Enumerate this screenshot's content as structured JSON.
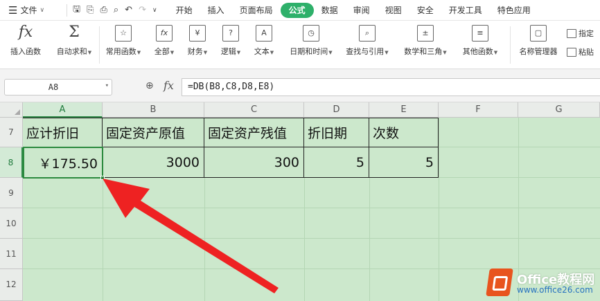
{
  "menu": {
    "file_label": "文件",
    "tabs": [
      "开始",
      "插入",
      "页面布局",
      "公式",
      "数据",
      "审阅",
      "视图",
      "安全",
      "开发工具",
      "特色应用"
    ],
    "active_tab": "公式"
  },
  "ribbon": {
    "buttons": [
      {
        "label": "插入函数",
        "icon": "fx-icon",
        "glyph": "fx",
        "dropdown": false
      },
      {
        "label": "自动求和",
        "icon": "sigma-icon",
        "glyph": "Σ",
        "dropdown": true
      },
      {
        "label": "常用函数",
        "icon": "star-function-icon",
        "glyph": "☆",
        "dropdown": true
      },
      {
        "label": "全部",
        "icon": "all-functions-icon",
        "glyph": "fx",
        "dropdown": true
      },
      {
        "label": "财务",
        "icon": "finance-icon",
        "glyph": "¥",
        "dropdown": true
      },
      {
        "label": "逻辑",
        "icon": "logic-icon",
        "glyph": "?",
        "dropdown": true
      },
      {
        "label": "文本",
        "icon": "text-icon",
        "glyph": "A",
        "dropdown": true
      },
      {
        "label": "日期和时间",
        "icon": "clock-icon",
        "glyph": "◷",
        "dropdown": true
      },
      {
        "label": "查找与引用",
        "icon": "lookup-icon",
        "glyph": "⌕",
        "dropdown": true
      },
      {
        "label": "数学和三角",
        "icon": "math-icon",
        "glyph": "±",
        "dropdown": true
      },
      {
        "label": "其他函数",
        "icon": "more-functions-icon",
        "glyph": "≡",
        "dropdown": true
      },
      {
        "label": "名称管理器",
        "icon": "name-manager-icon",
        "glyph": "▢",
        "dropdown": false
      }
    ],
    "small_buttons": [
      {
        "label": "指定",
        "icon": "specify-icon"
      },
      {
        "label": "粘贴",
        "icon": "paste-icon"
      }
    ]
  },
  "formula_bar": {
    "cell_ref": "A8",
    "formula": "=DB(B8,C8,D8,E8)"
  },
  "sheet": {
    "columns": [
      "A",
      "B",
      "C",
      "D",
      "E",
      "F",
      "G"
    ],
    "selected_column": "A",
    "rows": [
      "7",
      "8",
      "9",
      "10",
      "11",
      "12"
    ],
    "selected_row": "8",
    "headers": [
      "应计折旧",
      "固定资产原值",
      "固定资产残值",
      "折旧期",
      "次数"
    ],
    "values": [
      "￥175.50",
      "3000",
      "300",
      "5",
      "5"
    ]
  },
  "watermark": {
    "brand": "Office教程网",
    "url": "www.office26.com"
  },
  "colors": {
    "accent": "#2eb06a",
    "sheet_fill": "#cce8cc",
    "active_cell_border": "#2b8a3e",
    "arrow": "#ee2222",
    "logo": "#e8541e"
  }
}
